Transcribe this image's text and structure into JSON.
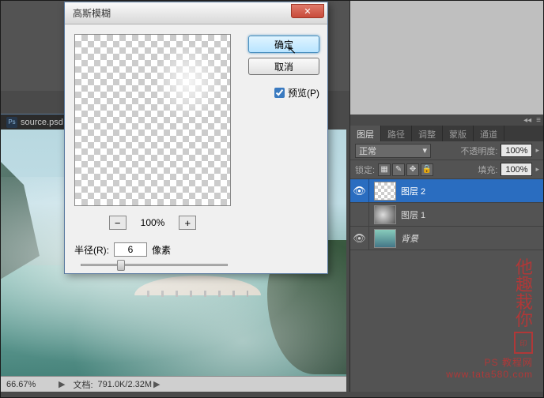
{
  "docTab": {
    "icon": "Ps",
    "title": "source.psd"
  },
  "statusBar": {
    "zoom": "66.67%",
    "arrow": "▶",
    "docLabel": "文档:",
    "docInfo": "791.0K/2.32M",
    "chev": "▶"
  },
  "dialog": {
    "title": "高斯模糊",
    "ok": "确定",
    "cancel": "取消",
    "previewLabel": "预览(P)",
    "zoomOut": "−",
    "zoomIn": "+",
    "zoomLevel": "100%",
    "radiusLabel": "半径(R):",
    "radiusValue": "6",
    "radiusUnit": "像素"
  },
  "panels": {
    "tabs": [
      "图层",
      "路径",
      "调整",
      "蒙版",
      "通道"
    ],
    "blendMode": "正常",
    "opacityLabel": "不透明度:",
    "opacityValue": "100%",
    "lockLabel": "锁定:",
    "fillLabel": "填充:",
    "fillValue": "100%",
    "layers": [
      {
        "name": "图层 2",
        "selected": true,
        "thumb": "checker",
        "eye": true
      },
      {
        "name": "图层 1",
        "selected": false,
        "thumb": "fog",
        "eye": false
      },
      {
        "name": "背景",
        "selected": false,
        "thumb": "bg",
        "eye": true,
        "italic": true
      }
    ]
  },
  "watermark": {
    "line1": "他",
    "line2": "趣",
    "line3": "栽",
    "line4": "你",
    "site1": "PS 教程网",
    "site2": "www.tata580.com"
  }
}
